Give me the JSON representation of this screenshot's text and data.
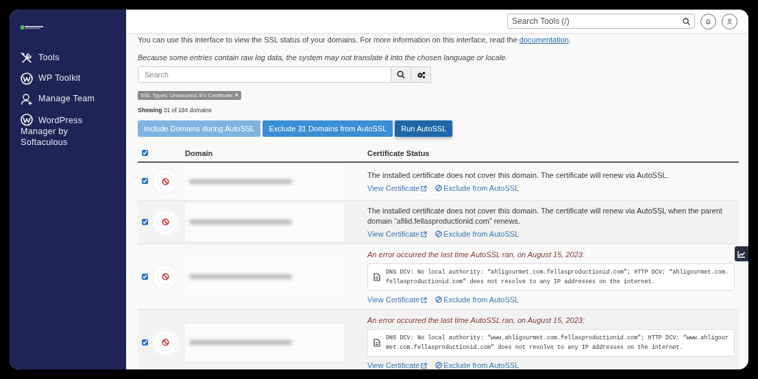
{
  "sidebar": {
    "items": [
      {
        "label": "Tools",
        "kind": "tools"
      },
      {
        "label": "WP Toolkit",
        "kind": "wordpress"
      },
      {
        "label": "Manage Team",
        "kind": "team"
      },
      {
        "label": "WordPress Manager by Softaculous",
        "kind": "wordpress"
      }
    ]
  },
  "header": {
    "search": {
      "placeholder": "Search Tools (/)"
    }
  },
  "intro": {
    "text": "You can use this interface to view the SSL status of your domains. For more information on this interface, read the",
    "link": "documentation",
    "end": "."
  },
  "note": "Because some entries contain raw log data, the system may not translate it into the chosen language or locale.",
  "search": {
    "placeholder": "Search"
  },
  "filter_tag": {
    "label": "SSL Types: Unsecured, EV Certificate",
    "remove": "×"
  },
  "showing": "**Showing** 31 of 184 domains",
  "buttons": [
    {
      "label": "Include Domains during AutoSSL",
      "kind": "light"
    },
    {
      "label": "Exclude 31 Domains from AutoSSL",
      "kind": "primary"
    },
    {
      "label": "Run AutoSSL",
      "kind": "dark"
    }
  ],
  "table": {
    "select_all_checked": true,
    "columns": [
      "Domain",
      "Certificate Status"
    ],
    "rows": [
      {
        "checked": true,
        "kind": "notice",
        "message": "The installed certificate does not cover this domain. The certificate will renew via AutoSSL.",
        "links": [
          "View Certificate",
          "Exclude from AutoSSL"
        ]
      },
      {
        "checked": true,
        "kind": "notice",
        "message": "The installed certificate does not cover this domain. The certificate will renew via AutoSSL when the parent domain “afilid.fellasproductionid.com” renews.",
        "links": [
          "View Certificate",
          "Exclude from AutoSSL"
        ]
      },
      {
        "checked": true,
        "kind": "error",
        "message": "An error occurred the last time AutoSSL ran, on August 15, 2023:",
        "log": "DNS DCV: No local authority: “ahligourmet.com.fellasproductionid.com”; HTTP DCV: “ahligourmet.com.fellasproductionid.com” does not resolve to any IP addresses on the internet.",
        "links": [
          "View Certificate",
          "Exclude from AutoSSL"
        ]
      },
      {
        "checked": true,
        "kind": "error",
        "message": "An error occurred the last time AutoSSL ran, on August 15, 2023:",
        "log": "DNS DCV: No local authority: “www.ahligourmet.com.fellasproductionid.com”; HTTP DCV: “www.ahligourmet.com.fellasproductionid.com” does not resolve to any IP addresses on the internet.",
        "links": [
          "View Certificate",
          "Exclude from AutoSSL"
        ]
      }
    ]
  }
}
